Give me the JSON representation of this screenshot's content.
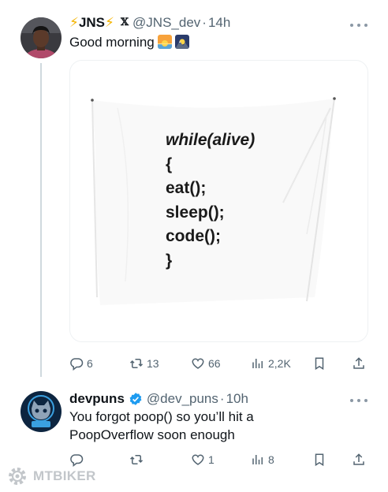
{
  "tweets": [
    {
      "display_name": "JNS",
      "display_prefix": "⚡",
      "display_suffix": "⚡",
      "platform_mark": "𝕏",
      "handle": "@JNS_dev",
      "separator": "·",
      "time": "14h",
      "text": "Good morning",
      "emojis": [
        "sunrise-emoji",
        "sunrise-over-mountains-emoji"
      ],
      "media": {
        "code_lines": [
          "while(alive)",
          "{",
          "eat();",
          "sleep();",
          "code();",
          "}"
        ]
      },
      "actions": {
        "replies": "6",
        "reposts": "13",
        "likes": "66",
        "views": "2,2K"
      }
    },
    {
      "display_name": "devpuns",
      "verified": true,
      "handle": "@dev_puns",
      "separator": "·",
      "time": "10h",
      "text": "You forgot poop() so you’ll hit a PoopOverflow soon enough",
      "actions": {
        "replies": "",
        "reposts": "",
        "likes": "1",
        "views": "8"
      }
    }
  ],
  "watermark": "MTBIKER",
  "colors": {
    "text": "#0f1419",
    "muted": "#536471",
    "thread_line": "#cfd9de",
    "verified": "#1d9bf0",
    "bolt": "#f4b400"
  },
  "icons": [
    "reply-icon",
    "repost-icon",
    "like-icon",
    "views-icon",
    "bookmark-icon",
    "share-icon",
    "more-icon"
  ]
}
